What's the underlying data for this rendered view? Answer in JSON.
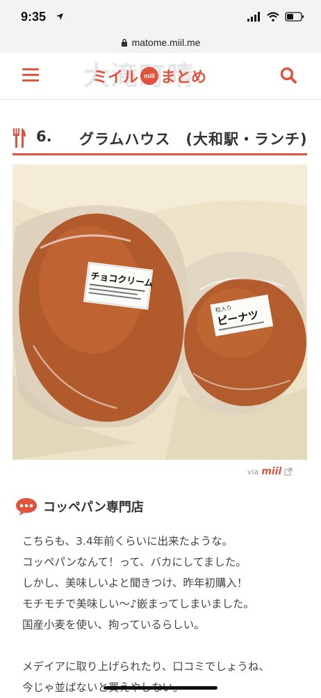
{
  "status_bar": {
    "time": "9:35"
  },
  "browser": {
    "url": "matome.miil.me"
  },
  "header": {
    "banner_ghost_text": "大滝町晴",
    "logo_left": "ミイル",
    "logo_mark": "miil",
    "logo_right": "まとめ"
  },
  "section": {
    "number": "6.",
    "title": "グラムハウス　(大和駅・ランチ)"
  },
  "photo": {
    "label_left_title": "チョコクリーム",
    "label_right_top": "粒入り",
    "label_right_title": "ピーナツ"
  },
  "credit": {
    "via": "via",
    "brand": "miil"
  },
  "subheading": "コッペパン専門店",
  "body_lines": [
    "こちらも、3.4年前くらいに出来たような。",
    "コッペパンなんて！って、バカにしてました。",
    "しかし、美味しいよと聞きつけ、昨年初購入！",
    "モチモチで美味しい〜♪嵌まってしまいました。",
    "国産小麦を使い、拘っているらしい。",
    "",
    "メデイアに取り上げられたり、口コミでしょうね、",
    "今じゃ並ばないと買えやしない。"
  ],
  "colors": {
    "accent": "#e0533d",
    "text": "#333333"
  }
}
